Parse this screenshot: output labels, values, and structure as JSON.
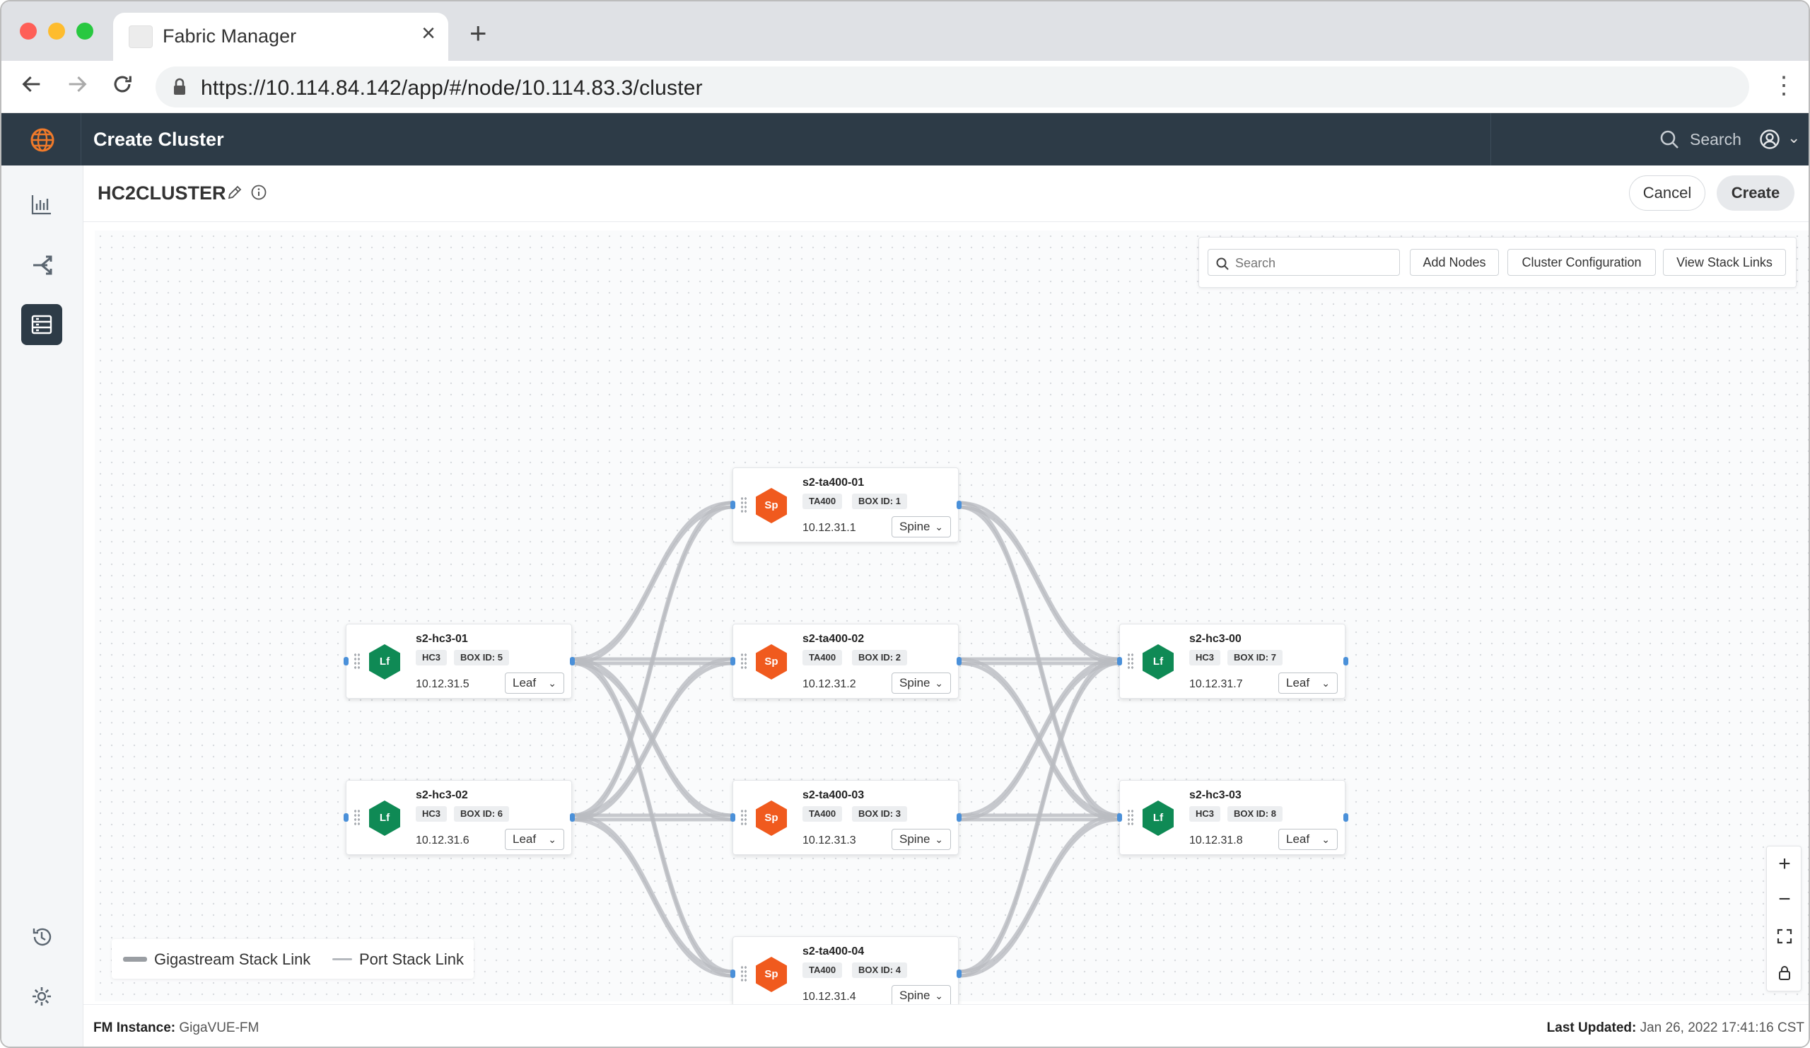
{
  "browser": {
    "tab_title": "Fabric Manager",
    "url": "https://10.114.84.142/app/#/node/10.114.83.3/cluster"
  },
  "appbar": {
    "title": "Create Cluster",
    "search_label": "Search"
  },
  "header": {
    "cluster_name": "HC2CLUSTER",
    "cancel_label": "Cancel",
    "create_label": "Create"
  },
  "toolbar": {
    "search_placeholder": "Search",
    "add_nodes_label": "Add Nodes",
    "cluster_config_label": "Cluster Configuration",
    "view_stack_links_label": "View Stack Links"
  },
  "nodes": [
    {
      "name": "s2-ta400-01",
      "icon": "Sp",
      "model": "TA400",
      "box": "BOX ID: 1",
      "ip": "10.12.31.1",
      "role": "Spine"
    },
    {
      "name": "s2-ta400-02",
      "icon": "Sp",
      "model": "TA400",
      "box": "BOX ID: 2",
      "ip": "10.12.31.2",
      "role": "Spine"
    },
    {
      "name": "s2-ta400-03",
      "icon": "Sp",
      "model": "TA400",
      "box": "BOX ID: 3",
      "ip": "10.12.31.3",
      "role": "Spine"
    },
    {
      "name": "s2-ta400-04",
      "icon": "Sp",
      "model": "TA400",
      "box": "BOX ID: 4",
      "ip": "10.12.31.4",
      "role": "Spine"
    },
    {
      "name": "s2-hc3-01",
      "icon": "Lf",
      "model": "HC3",
      "box": "BOX ID: 5",
      "ip": "10.12.31.5",
      "role": "Leaf"
    },
    {
      "name": "s2-hc3-02",
      "icon": "Lf",
      "model": "HC3",
      "box": "BOX ID: 6",
      "ip": "10.12.31.6",
      "role": "Leaf"
    },
    {
      "name": "s2-hc3-00",
      "icon": "Lf",
      "model": "HC3",
      "box": "BOX ID: 7",
      "ip": "10.12.31.7",
      "role": "Leaf"
    },
    {
      "name": "s2-hc3-03",
      "icon": "Lf",
      "model": "HC3",
      "box": "BOX ID: 8",
      "ip": "10.12.31.8",
      "role": "Leaf"
    }
  ],
  "legend": {
    "gigastream": "Gigastream Stack Link",
    "port": "Port Stack Link"
  },
  "zoom": {
    "in": "+",
    "out": "−"
  },
  "footer": {
    "instance_label": "FM Instance:",
    "instance_value": "GigaVUE-FM",
    "updated_label": "Last Updated:",
    "updated_value": "Jan 26, 2022 17:41:16 CST"
  },
  "colors": {
    "spine": "#f05a1e",
    "leaf": "#0f8a55",
    "appbar": "#2d3b47",
    "link": "#b9bcc0",
    "port": "#4a90d9"
  },
  "icons": [
    "back-icon",
    "forward-icon",
    "reload-icon",
    "lock-icon",
    "kebab-menu-icon",
    "globe-logo-icon",
    "search-icon",
    "user-icon",
    "chart-icon",
    "topology-icon",
    "cluster-list-icon",
    "history-icon",
    "gear-icon",
    "pencil-icon",
    "info-icon",
    "expand-icon",
    "lock-icon"
  ]
}
